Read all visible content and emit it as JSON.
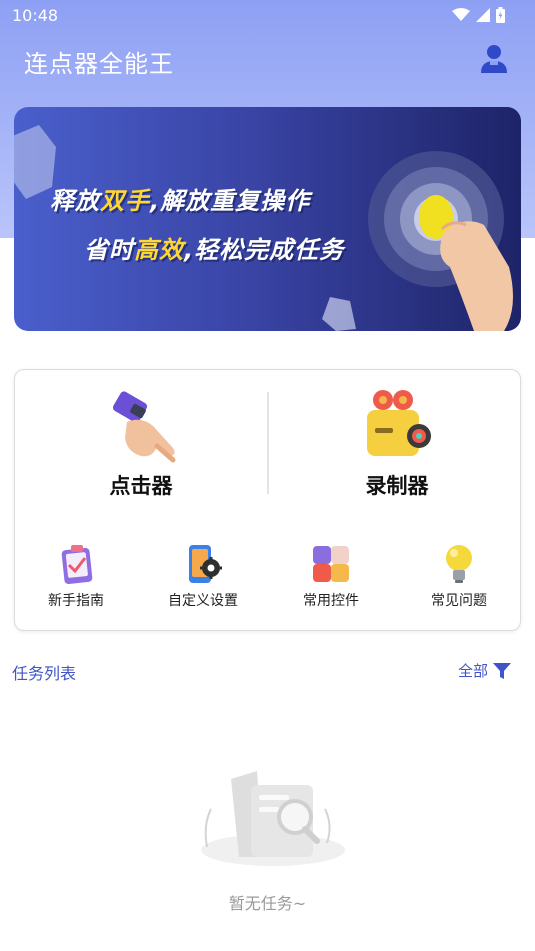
{
  "status_bar": {
    "time": "10:48"
  },
  "header": {
    "title": "连点器全能王",
    "user_icon": "user-icon"
  },
  "banner": {
    "line1_pre": "释放",
    "line1_hl": "双手",
    "line1_post": ",解放重复操作",
    "line2_pre": "省时",
    "line2_hl": "高效",
    "line2_post": ",轻松完成任务",
    "highlight_color": "#ffd735"
  },
  "tools": {
    "clicker_label": "点击器",
    "recorder_label": "录制器",
    "shortcuts": [
      {
        "label": "新手指南",
        "icon": "guide-clipboard-icon"
      },
      {
        "label": "自定义设置",
        "icon": "phone-gear-icon"
      },
      {
        "label": "常用控件",
        "icon": "cube-icon"
      },
      {
        "label": "常见问题",
        "icon": "lightbulb-icon"
      }
    ]
  },
  "task_list": {
    "title": "任务列表",
    "filter_label": "全部",
    "empty_text": "暂无任务~"
  },
  "colors": {
    "accent": "#3f55c8",
    "header_bg": "#8ea0f4",
    "banner_bg": "#3a45a6"
  }
}
